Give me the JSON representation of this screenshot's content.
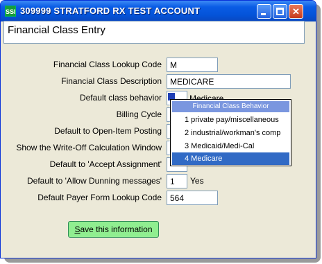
{
  "window": {
    "title": "309999 STRATFORD RX TEST ACCOUNT",
    "icon_label": "SSI",
    "minimize_icon": "minimize-icon",
    "maximize_icon": "maximize-icon",
    "close_icon": "close-icon"
  },
  "header": {
    "title": "Financial Class Entry"
  },
  "fields": {
    "lookup_code": {
      "label": "Financial Class Lookup Code",
      "value": "M"
    },
    "description": {
      "label": "Financial Class Description",
      "value": "MEDICARE"
    },
    "default_behavior": {
      "label": "Default class behavior",
      "value": "4",
      "after": "Medicare"
    },
    "billing_cycle": {
      "label": "Billing Cycle"
    },
    "open_item": {
      "label": "Default to Open-Item Posting"
    },
    "writeoff_window": {
      "label": "Show the Write-Off Calculation Window"
    },
    "accept_assignment": {
      "label": "Default to 'Accept Assignment'"
    },
    "allow_dunning": {
      "label": "Default to 'Allow Dunning messages'",
      "value": "1",
      "after": "Yes"
    },
    "payer_form": {
      "label": "Default Payer Form Lookup Code",
      "value": "564"
    }
  },
  "save_button": {
    "label_accesskey": "S",
    "label_rest": "ave this information"
  },
  "dropdown": {
    "header": "Financial Class Behavior",
    "items": [
      "1 private pay/miscellaneous",
      "2 industrial/workman's comp",
      "3 Medicaid/Medi-Cal",
      "4 Medicare"
    ],
    "selected_index": 3
  },
  "colors": {
    "titlebar": "#0a5ce5",
    "save_button": "#90ee90",
    "dropdown_header": "#7a96df",
    "selection": "#316ac5"
  }
}
